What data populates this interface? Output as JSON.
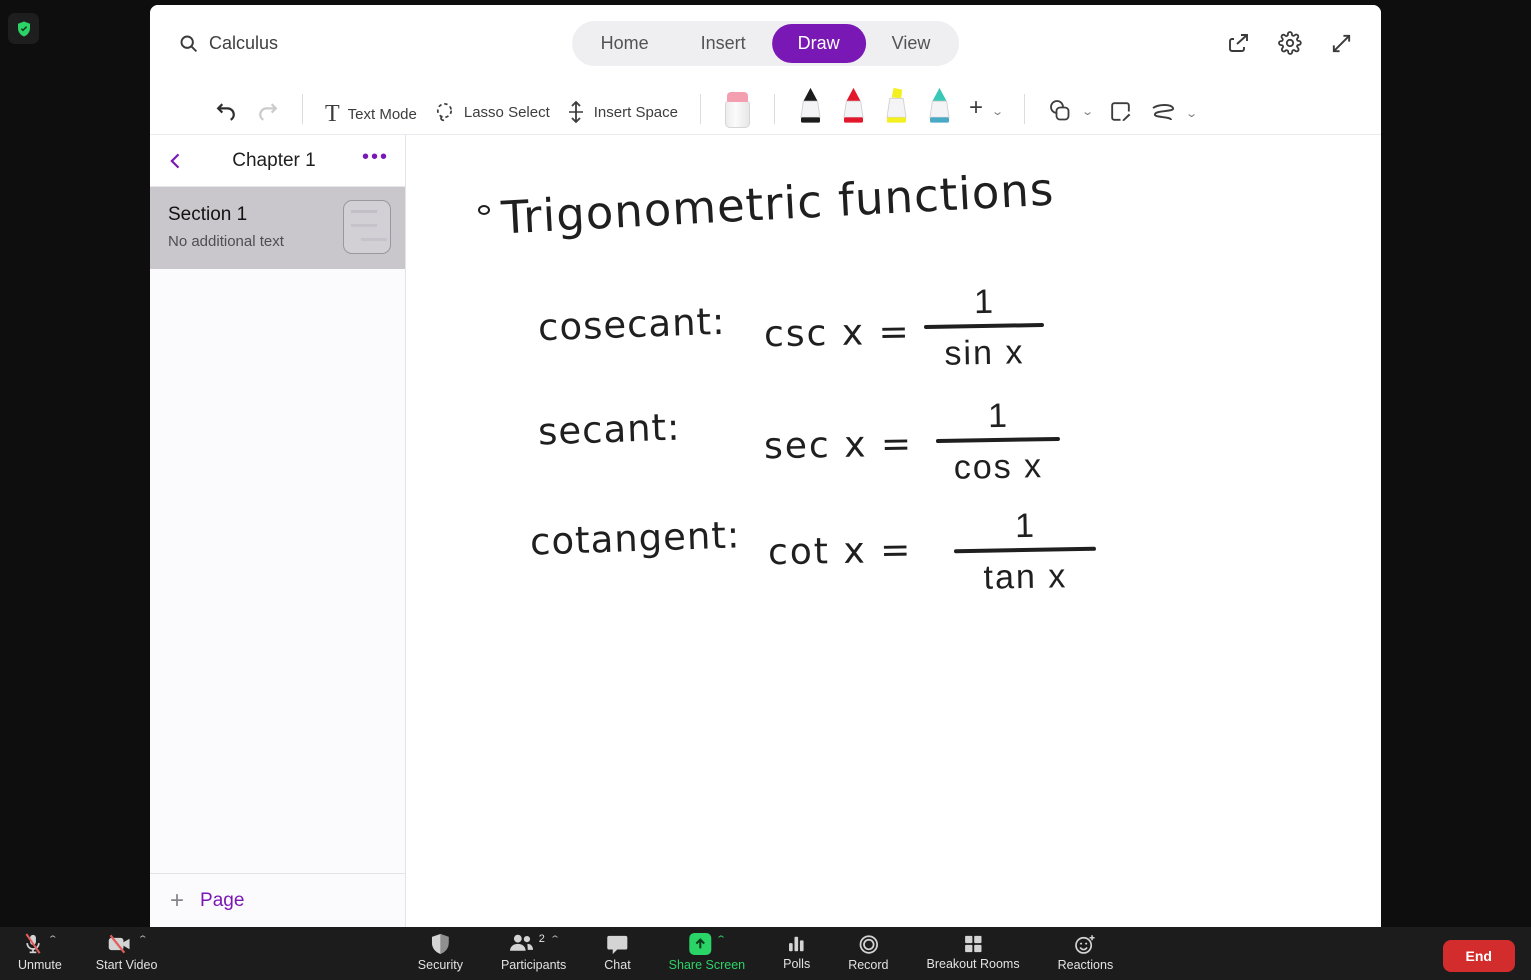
{
  "colors": {
    "accent_purple": "#7a18b5",
    "share_green": "#2bd466",
    "end_red": "#d22c2c"
  },
  "onenote": {
    "search": {
      "query": "Calculus"
    },
    "tabs": [
      {
        "label": "Home"
      },
      {
        "label": "Insert"
      },
      {
        "label": "Draw"
      },
      {
        "label": "View"
      }
    ],
    "active_tab": "Draw",
    "ribbon": {
      "text_mode_label": "Text Mode",
      "lasso_select_label": "Lasso Select",
      "insert_space_label": "Insert Space"
    },
    "sidebar": {
      "title": "Chapter 1",
      "sections": [
        {
          "title": "Section 1",
          "subtitle": "No additional text"
        }
      ],
      "add_page_label": "Page"
    },
    "canvas": {
      "title": "Trigonometric functions",
      "formulas": [
        {
          "name": "cosecant:",
          "lhs": "csc x =",
          "numerator": "1",
          "denominator": "sin x"
        },
        {
          "name": "secant:",
          "lhs": "sec x =",
          "numerator": "1",
          "denominator": "cos x"
        },
        {
          "name": "cotangent:",
          "lhs": "cot x =",
          "numerator": "1",
          "denominator": "tan x"
        }
      ]
    }
  },
  "zoom_toolbar": {
    "unmute": "Unmute",
    "start_video": "Start Video",
    "security": "Security",
    "participants": "Participants",
    "participants_count": "2",
    "chat": "Chat",
    "share_screen": "Share Screen",
    "polls": "Polls",
    "record": "Record",
    "breakout_rooms": "Breakout Rooms",
    "reactions": "Reactions",
    "end": "End"
  }
}
